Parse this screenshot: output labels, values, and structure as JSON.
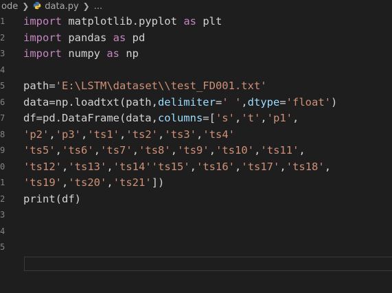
{
  "breadcrumb": {
    "folder": "ode",
    "file": "data.py",
    "more": "..."
  },
  "gutter": {
    "line_numbers": [
      "1",
      "2",
      "3",
      "4",
      "5",
      "6",
      "7",
      "8",
      "9",
      "0",
      "1",
      "2",
      "3",
      "4",
      "5"
    ]
  },
  "code": {
    "lines": [
      [
        {
          "t": "import",
          "c": "kw"
        },
        {
          "t": " matplotlib.pyplot ",
          "c": "plain"
        },
        {
          "t": "as",
          "c": "kw"
        },
        {
          "t": " plt",
          "c": "plain"
        }
      ],
      [
        {
          "t": "import",
          "c": "kw"
        },
        {
          "t": " pandas ",
          "c": "plain"
        },
        {
          "t": "as",
          "c": "kw"
        },
        {
          "t": " pd",
          "c": "plain"
        }
      ],
      [
        {
          "t": "import",
          "c": "kw"
        },
        {
          "t": " numpy ",
          "c": "plain"
        },
        {
          "t": "as",
          "c": "kw"
        },
        {
          "t": " np",
          "c": "plain"
        }
      ],
      [],
      [
        {
          "t": "path=",
          "c": "plain"
        },
        {
          "t": "'E:\\LSTM\\dataset\\\\test_FD001.txt'",
          "c": "str"
        }
      ],
      [
        {
          "t": "data=np.loadtxt(path,",
          "c": "plain"
        },
        {
          "t": "delimiter",
          "c": "param"
        },
        {
          "t": "=",
          "c": "plain"
        },
        {
          "t": "' '",
          "c": "str"
        },
        {
          "t": ",",
          "c": "plain"
        },
        {
          "t": "dtype",
          "c": "param"
        },
        {
          "t": "=",
          "c": "plain"
        },
        {
          "t": "'float'",
          "c": "str"
        },
        {
          "t": ")",
          "c": "plain"
        }
      ],
      [
        {
          "t": "df=pd.DataFrame(data,",
          "c": "plain"
        },
        {
          "t": "columns",
          "c": "param"
        },
        {
          "t": "=[",
          "c": "plain"
        },
        {
          "t": "'s'",
          "c": "str"
        },
        {
          "t": ",",
          "c": "plain"
        },
        {
          "t": "'t'",
          "c": "str"
        },
        {
          "t": ",",
          "c": "plain"
        },
        {
          "t": "'p1'",
          "c": "str"
        },
        {
          "t": ",",
          "c": "plain"
        }
      ],
      [
        {
          "t": "'p2'",
          "c": "str"
        },
        {
          "t": ",",
          "c": "plain"
        },
        {
          "t": "'p3'",
          "c": "str"
        },
        {
          "t": ",",
          "c": "plain"
        },
        {
          "t": "'ts1'",
          "c": "str"
        },
        {
          "t": ",",
          "c": "plain"
        },
        {
          "t": "'ts2'",
          "c": "str"
        },
        {
          "t": ",",
          "c": "plain"
        },
        {
          "t": "'ts3'",
          "c": "str"
        },
        {
          "t": ",",
          "c": "plain"
        },
        {
          "t": "'ts4'",
          "c": "str"
        }
      ],
      [
        {
          "t": "'ts5'",
          "c": "str"
        },
        {
          "t": ",",
          "c": "plain"
        },
        {
          "t": "'ts6'",
          "c": "str"
        },
        {
          "t": ",",
          "c": "plain"
        },
        {
          "t": "'ts7'",
          "c": "str"
        },
        {
          "t": ",",
          "c": "plain"
        },
        {
          "t": "'ts8'",
          "c": "str"
        },
        {
          "t": ",",
          "c": "plain"
        },
        {
          "t": "'ts9'",
          "c": "str"
        },
        {
          "t": ",",
          "c": "plain"
        },
        {
          "t": "'ts10'",
          "c": "str"
        },
        {
          "t": ",",
          "c": "plain"
        },
        {
          "t": "'ts11'",
          "c": "str"
        },
        {
          "t": ",",
          "c": "plain"
        }
      ],
      [
        {
          "t": "'ts12'",
          "c": "str"
        },
        {
          "t": ",",
          "c": "plain"
        },
        {
          "t": "'ts13'",
          "c": "str"
        },
        {
          "t": ",",
          "c": "plain"
        },
        {
          "t": "'ts14''ts15'",
          "c": "str"
        },
        {
          "t": ",",
          "c": "plain"
        },
        {
          "t": "'ts16'",
          "c": "str"
        },
        {
          "t": ",",
          "c": "plain"
        },
        {
          "t": "'ts17'",
          "c": "str"
        },
        {
          "t": ",",
          "c": "plain"
        },
        {
          "t": "'ts18'",
          "c": "str"
        },
        {
          "t": ",",
          "c": "plain"
        }
      ],
      [
        {
          "t": "'ts19'",
          "c": "str"
        },
        {
          "t": ",",
          "c": "plain"
        },
        {
          "t": "'ts20'",
          "c": "str"
        },
        {
          "t": ",",
          "c": "plain"
        },
        {
          "t": "'ts21'",
          "c": "str"
        },
        {
          "t": "])",
          "c": "plain"
        }
      ],
      [
        {
          "t": "print(df)",
          "c": "plain"
        }
      ],
      [],
      [],
      []
    ]
  },
  "colors": {
    "background": "#1e1e1e",
    "keyword": "#c586c0",
    "string": "#ce9178",
    "parameter": "#9cdcfe",
    "text": "#d4d4d4",
    "line_number": "#858585"
  }
}
